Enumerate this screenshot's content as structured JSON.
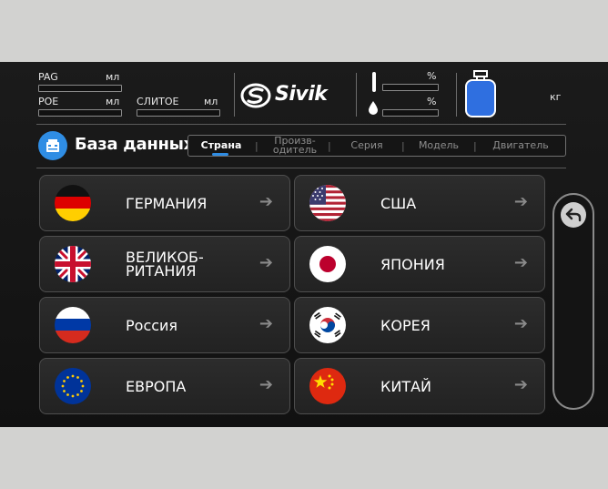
{
  "header": {
    "pag_label": "PAG",
    "pag_unit": "мл",
    "poe_label": "POE",
    "poe_unit": "мл",
    "dye_label": "СЛИТОЕ",
    "dye_unit": "мл",
    "brand": "Sivik",
    "gauge_unit_1": "%",
    "gauge_unit_2": "%",
    "tank_unit": "кг",
    "tank_icon": "refrigerant-tank-icon",
    "accent_color": "#2f8de4"
  },
  "database": {
    "title": "База данных",
    "icon": "database-icon"
  },
  "tabs": [
    {
      "label": "Страна",
      "active": true
    },
    {
      "label": "Произв-\nодитель",
      "active": false
    },
    {
      "label": "Серия",
      "active": false
    },
    {
      "label": "Модель",
      "active": false
    },
    {
      "label": "Двигатель",
      "active": false
    }
  ],
  "countries": [
    {
      "name": "ГЕРМАНИЯ",
      "flag": "germany-flag-icon"
    },
    {
      "name": "США",
      "flag": "usa-flag-icon"
    },
    {
      "name": "ВЕЛИКОБ-\nРИТАНИЯ",
      "flag": "uk-flag-icon"
    },
    {
      "name": "ЯПОНИЯ",
      "flag": "japan-flag-icon"
    },
    {
      "name": "Россия",
      "flag": "russia-flag-icon"
    },
    {
      "name": "КОРЕЯ",
      "flag": "korea-flag-icon"
    },
    {
      "name": "ЕВРОПА",
      "flag": "eu-flag-icon"
    },
    {
      "name": "КИТАЙ",
      "flag": "china-flag-icon"
    }
  ],
  "arrow_glyph": "➔",
  "back_icon": "back-arrow-icon"
}
